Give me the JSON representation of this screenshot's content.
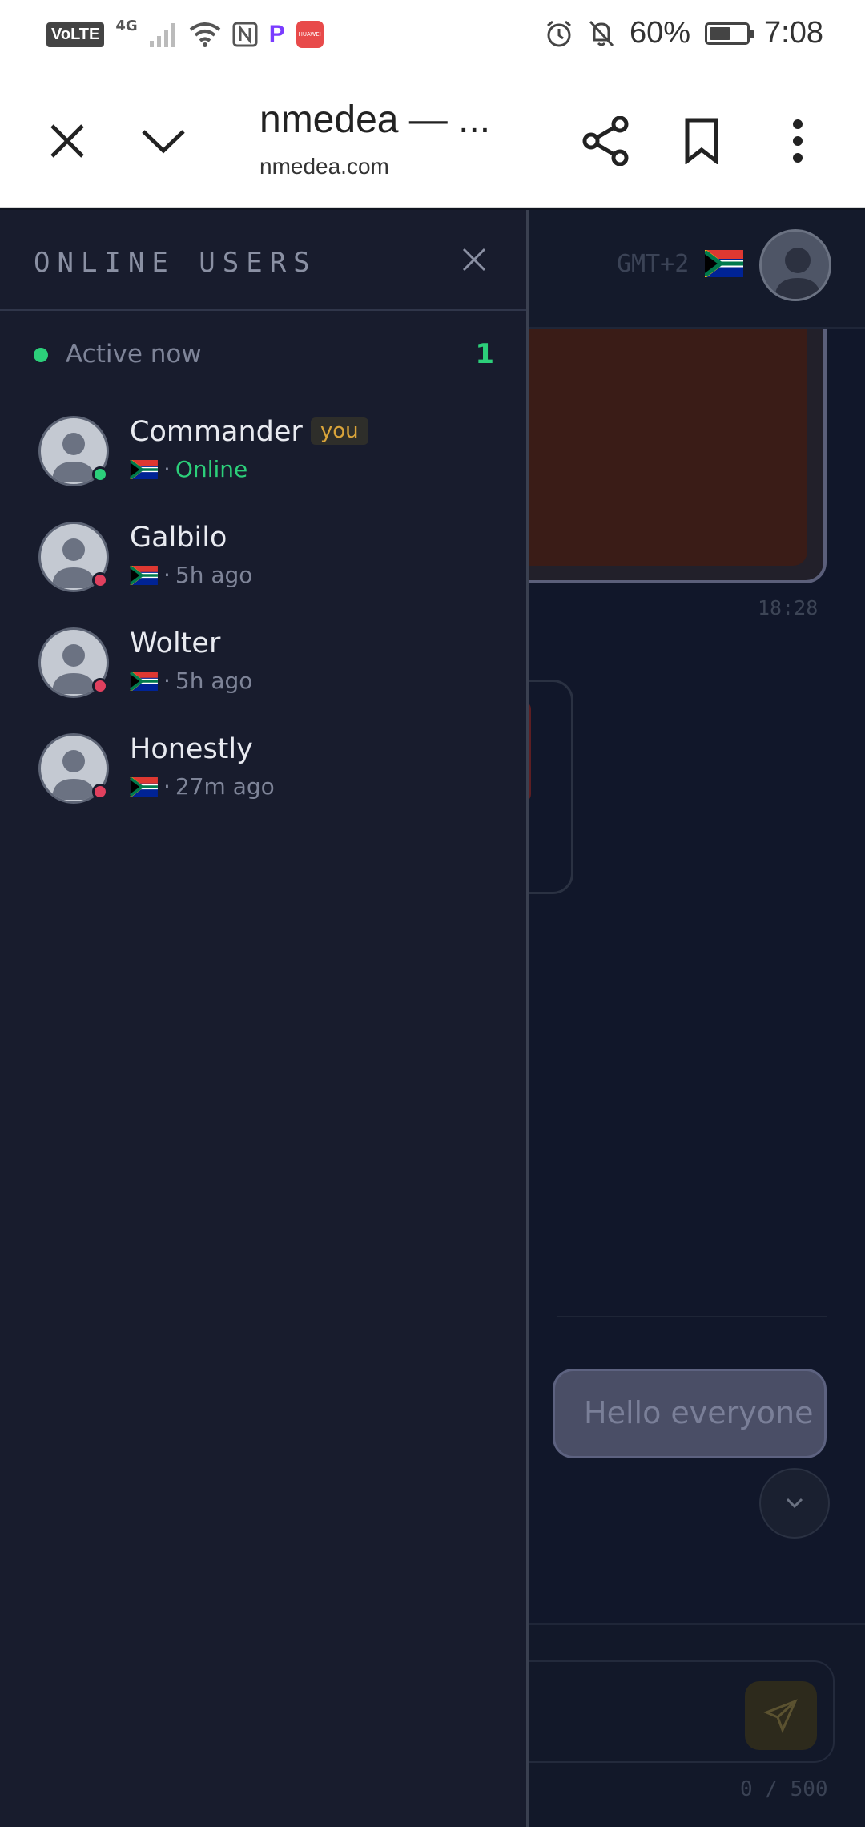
{
  "status_bar": {
    "volte": "VoLTE",
    "network": "4G",
    "app_badge": "HUAWEI",
    "battery": "60%",
    "battery_level": 0.6,
    "time": "7:08"
  },
  "browser": {
    "page_title": "nmedea — ...",
    "url": "nmedea.com"
  },
  "background_chat": {
    "timezone": "GMT+2",
    "message_time": "18:28",
    "bubble_text": "Hello everyone",
    "counter": "0 / 500"
  },
  "drawer": {
    "title": "ONLINE USERS",
    "active_label": "Active now",
    "active_count": "1",
    "colors": {
      "online": "#2ccf7a",
      "offline": "#e0405e",
      "you_badge": "#d9a43a"
    },
    "users": [
      {
        "name": "Commander",
        "you_label": "you",
        "status": "Online",
        "online": true
      },
      {
        "name": "Galbilo",
        "status": "5h ago",
        "online": false
      },
      {
        "name": "Wolter",
        "status": "5h ago",
        "online": false
      },
      {
        "name": "Honestly",
        "status": "27m ago",
        "online": false
      }
    ]
  }
}
